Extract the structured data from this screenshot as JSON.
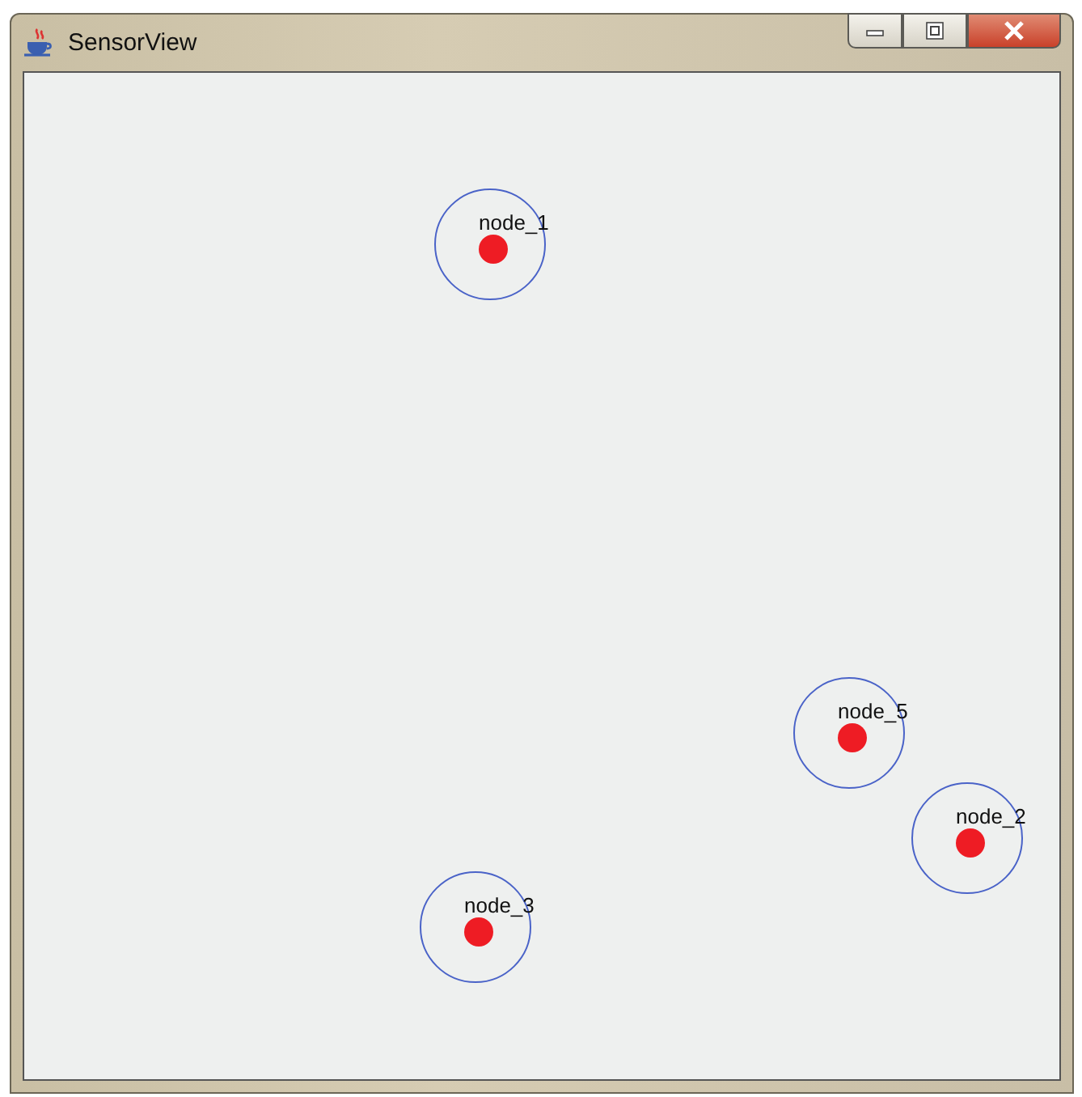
{
  "window": {
    "title": "SensorView"
  },
  "nodes": [
    {
      "label": "node_1"
    },
    {
      "label": "node_5"
    },
    {
      "label": "node_2"
    },
    {
      "label": "node_3"
    }
  ]
}
